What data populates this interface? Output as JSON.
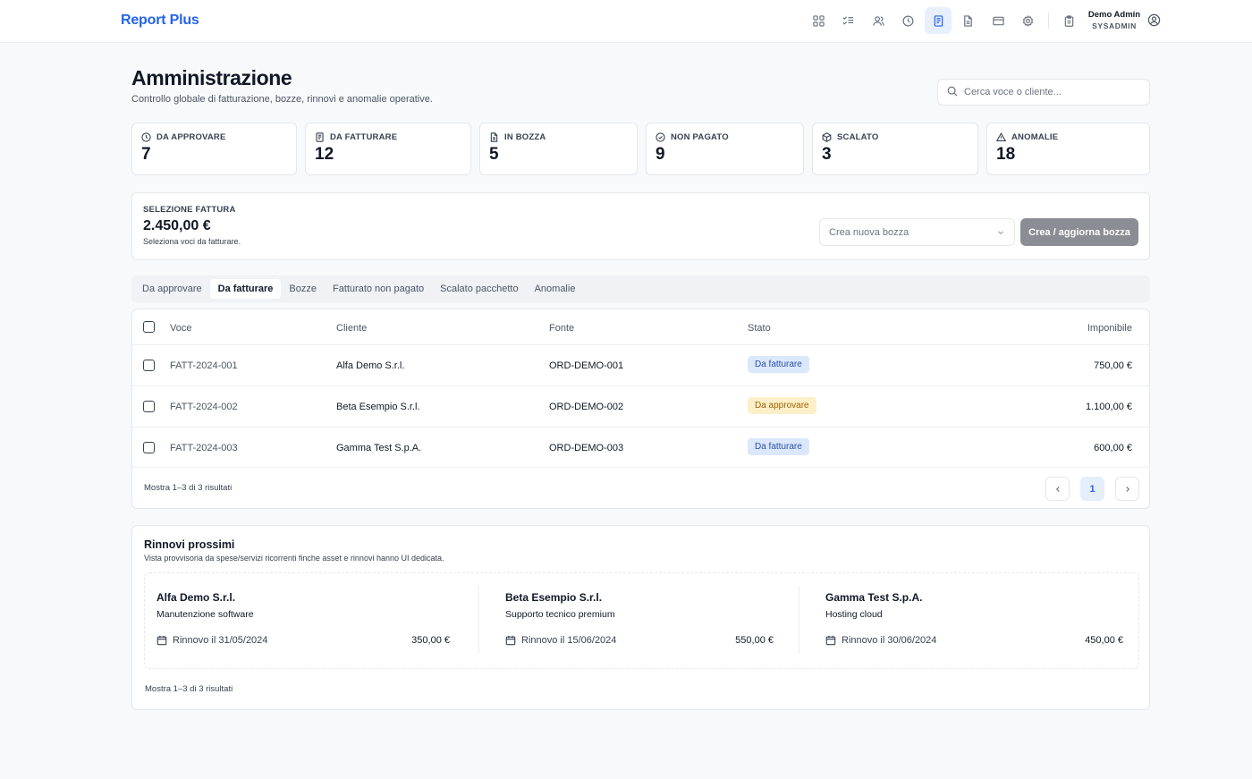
{
  "app": {
    "brand": "Report Plus"
  },
  "user": {
    "name": "Demo Admin",
    "role": "SYSADMIN"
  },
  "nav": {
    "icons": [
      "grid-icon",
      "list-check-icon",
      "users-icon",
      "clock-icon",
      "invoice-icon",
      "document-icon",
      "card-icon",
      "gear-icon",
      "clipboard-icon"
    ],
    "active": "invoice-icon"
  },
  "header": {
    "title": "Amministrazione",
    "subtitle": "Controllo globale di fatturazione, bozze, rinnovi e anomalie operative.",
    "search_placeholder": "Cerca voce o cliente..."
  },
  "stats": [
    {
      "label": "DA APPROVARE",
      "value": "7",
      "icon": "clock-icon"
    },
    {
      "label": "DA FATTURARE",
      "value": "12",
      "icon": "receipt-icon"
    },
    {
      "label": "IN BOZZA",
      "value": "5",
      "icon": "document-icon"
    },
    {
      "label": "NON PAGATO",
      "value": "9",
      "icon": "check-circle-icon"
    },
    {
      "label": "SCALATO",
      "value": "3",
      "icon": "package-icon"
    },
    {
      "label": "ANOMALIE",
      "value": "18",
      "icon": "warning-icon"
    }
  ],
  "selection": {
    "label": "SELEZIONE FATTURA",
    "amount": "2.450,00 €",
    "hint": "Seleziona voci da fatturare.",
    "select_placeholder": "Crea nuova bozza",
    "button": "Crea / aggiorna bozza"
  },
  "tabs": [
    {
      "label": "Da approvare"
    },
    {
      "label": "Da fatturare"
    },
    {
      "label": "Bozze"
    },
    {
      "label": "Fatturato non pagato"
    },
    {
      "label": "Scalato pacchetto"
    },
    {
      "label": "Anomalie"
    }
  ],
  "active_tab": "Da fatturare",
  "table": {
    "columns": [
      "Voce",
      "Cliente",
      "Fonte",
      "Stato",
      "Imponibile"
    ],
    "rows": [
      {
        "voce": "FATT-2024-001",
        "cliente": "Alfa Demo S.r.l.",
        "fonte": "ORD-DEMO-001",
        "stato": "Da fatturare",
        "imponibile": "750,00 €"
      },
      {
        "voce": "FATT-2024-002",
        "cliente": "Beta Esempio S.r.l.",
        "fonte": "ORD-DEMO-002",
        "stato": "Da approvare",
        "imponibile": "1.100,00 €"
      },
      {
        "voce": "FATT-2024-003",
        "cliente": "Gamma Test S.p.A.",
        "fonte": "ORD-DEMO-003",
        "stato": "Da fatturare",
        "imponibile": "600,00 €"
      }
    ],
    "footer": "Mostra 1–3 di 3 risultati",
    "page": "1"
  },
  "renewals": {
    "title": "Rinnovi prossimi",
    "subtitle": "Vista provvisoria da spese/servizi ricorrenti finche asset e rinnovi hanno UI dedicata.",
    "items": [
      {
        "client": "Alfa Demo S.r.l.",
        "service": "Manutenzione software",
        "date": "Rinnovo il 31/05/2024",
        "amount": "350,00 €"
      },
      {
        "client": "Beta Esempio S.r.l.",
        "service": "Supporto tecnico premium",
        "date": "Rinnovo il 15/06/2024",
        "amount": "550,00 €"
      },
      {
        "client": "Gamma Test S.p.A.",
        "service": "Hosting cloud",
        "date": "Rinnovo il 30/06/2024",
        "amount": "450,00 €"
      }
    ],
    "footer": "Mostra 1–3 di 3 risultati"
  },
  "colors": {
    "brand": "#2563eb",
    "badge_blue": "#dbe7fb",
    "badge_amber": "#fdf0c8"
  }
}
